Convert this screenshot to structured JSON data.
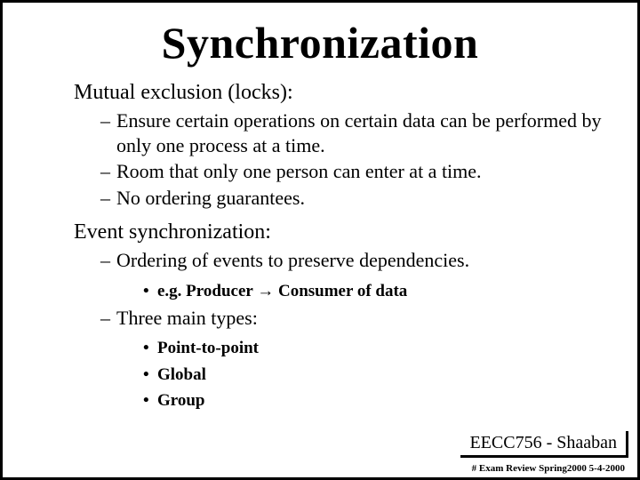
{
  "title": "Synchronization",
  "sections": [
    {
      "heading": "Mutual exclusion (locks):",
      "dashes": [
        "Ensure certain operations on certain data can be performed by only one process at a time.",
        "Room that only one person can enter at a time.",
        "No ordering guarantees."
      ]
    },
    {
      "heading": "Event synchronization:",
      "dashes_line_first": " Ordering of events to preserve dependencies.",
      "example_prefix": "e.g.  Producer ",
      "example_suffix": "  Consumer of data",
      "types_heading": " Three main types:",
      "types": [
        "Point-to-point",
        "Global",
        "Group"
      ]
    }
  ],
  "footer_box": "EECC756 - Shaaban",
  "footer_small": "#   Exam Review  Spring2000  5-4-2000"
}
